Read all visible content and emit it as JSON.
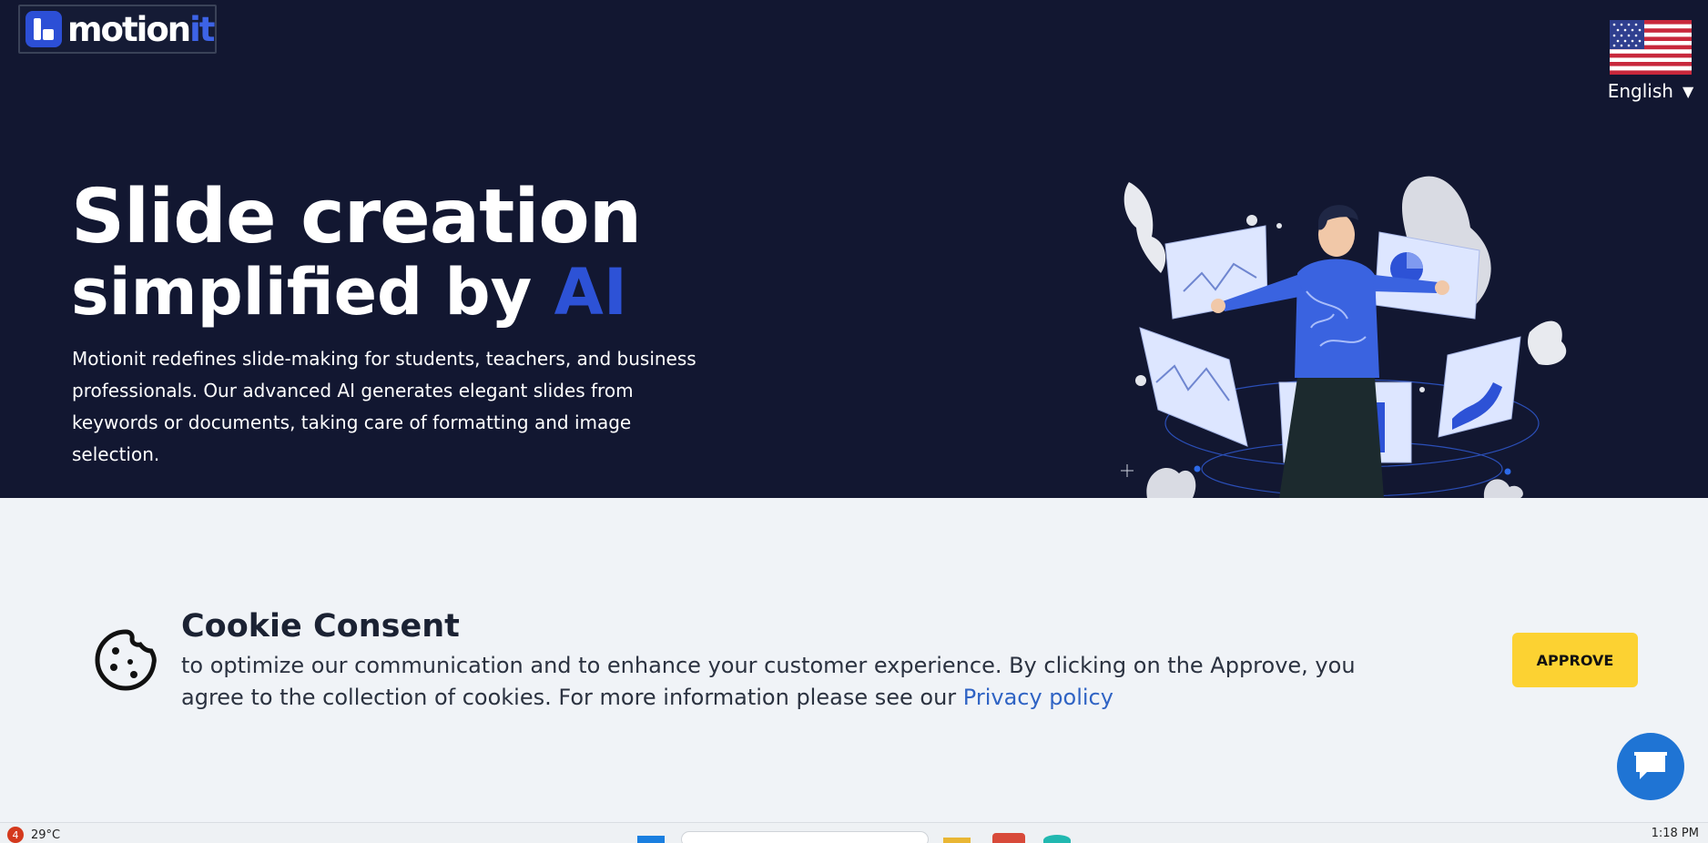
{
  "brand": {
    "name_main": "motion",
    "name_accent": "it"
  },
  "language": {
    "label": "English",
    "caret": "▼"
  },
  "hero": {
    "title_line1": "Slide creation",
    "title_line2_prefix": "simplified by ",
    "title_line2_accent": "AI",
    "description": "Motionit redefines slide-making for students, teachers, and business professionals. Our advanced AI generates elegant slides from keywords or documents, taking care of formatting and image selection."
  },
  "cookie": {
    "title": "Cookie Consent",
    "text": "to optimize our communication and to enhance your customer experience. By clicking on the Approve, you agree to the collection of cookies. For more information please see our ",
    "link_text": "Privacy policy",
    "approve_label": "APPROVE"
  },
  "taskbar": {
    "weather_badge": "4",
    "temperature": "29°C",
    "time": "1:18 PM"
  },
  "colors": {
    "hero_bg": "#121731",
    "accent_blue": "#2d52d6",
    "approve_yellow": "#fcd232",
    "chat_blue": "#1f74d4",
    "link_blue": "#2f63c4"
  },
  "icons": [
    "logo-icon",
    "us-flag-icon",
    "cookie-icon",
    "chat-icon",
    "windows-start-icon",
    "search-icon",
    "folder-icon"
  ]
}
